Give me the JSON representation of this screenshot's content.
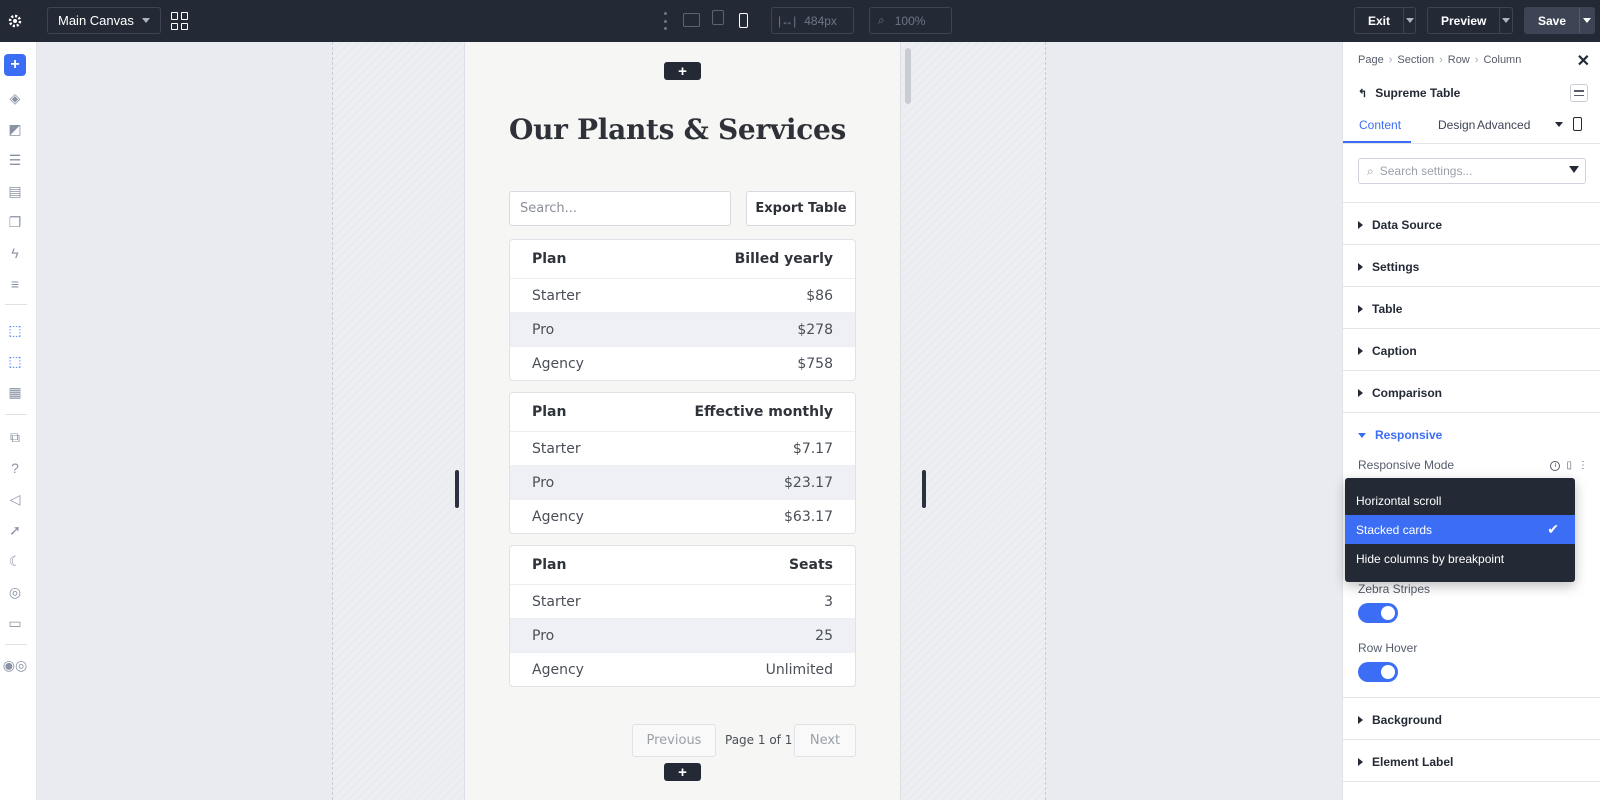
{
  "topbar": {
    "canvas_select": "Main Canvas",
    "width_value": "484px",
    "zoom_value": "100%",
    "exit_label": "Exit",
    "preview_label": "Preview",
    "save_label": "Save"
  },
  "page": {
    "title": "Our Plants & Services",
    "search_placeholder": "Search...",
    "export_label": "Export Table",
    "cards": [
      {
        "header": [
          "Plan",
          "Billed yearly"
        ],
        "rows": [
          [
            "Starter",
            "$86"
          ],
          [
            "Pro",
            "$278"
          ],
          [
            "Agency",
            "$758"
          ]
        ]
      },
      {
        "header": [
          "Plan",
          "Effective monthly"
        ],
        "rows": [
          [
            "Starter",
            "$7.17"
          ],
          [
            "Pro",
            "$23.17"
          ],
          [
            "Agency",
            "$63.17"
          ]
        ]
      },
      {
        "header": [
          "Plan",
          "Seats"
        ],
        "rows": [
          [
            "Starter",
            "3"
          ],
          [
            "Pro",
            "25"
          ],
          [
            "Agency",
            "Unlimited"
          ]
        ]
      }
    ],
    "pager": {
      "previous": "Previous",
      "info": "Page 1 of 1",
      "next": "Next"
    }
  },
  "panel": {
    "breadcrumb": [
      "Page",
      "Section",
      "Row",
      "Column"
    ],
    "module_title": "Supreme Table",
    "tabs": [
      "Content",
      "Design",
      "Advanced"
    ],
    "active_tab": "Content",
    "search_placeholder": "Search settings...",
    "sections_top": [
      "Data Source",
      "Settings",
      "Table",
      "Caption",
      "Comparison"
    ],
    "open_section": "Responsive",
    "responsive_mode_label": "Responsive Mode",
    "responsive_options": [
      "Horizontal scroll",
      "Stacked cards",
      "Hide columns by breakpoint"
    ],
    "responsive_selected": "Stacked cards",
    "zebra_label": "Zebra Stripes",
    "zebra_on": true,
    "hover_label": "Row Hover",
    "hover_on": true,
    "sections_bottom": [
      "Background",
      "Element Label"
    ]
  },
  "colors": {
    "accent": "#3b6ef5",
    "topbar": "#242a35"
  }
}
